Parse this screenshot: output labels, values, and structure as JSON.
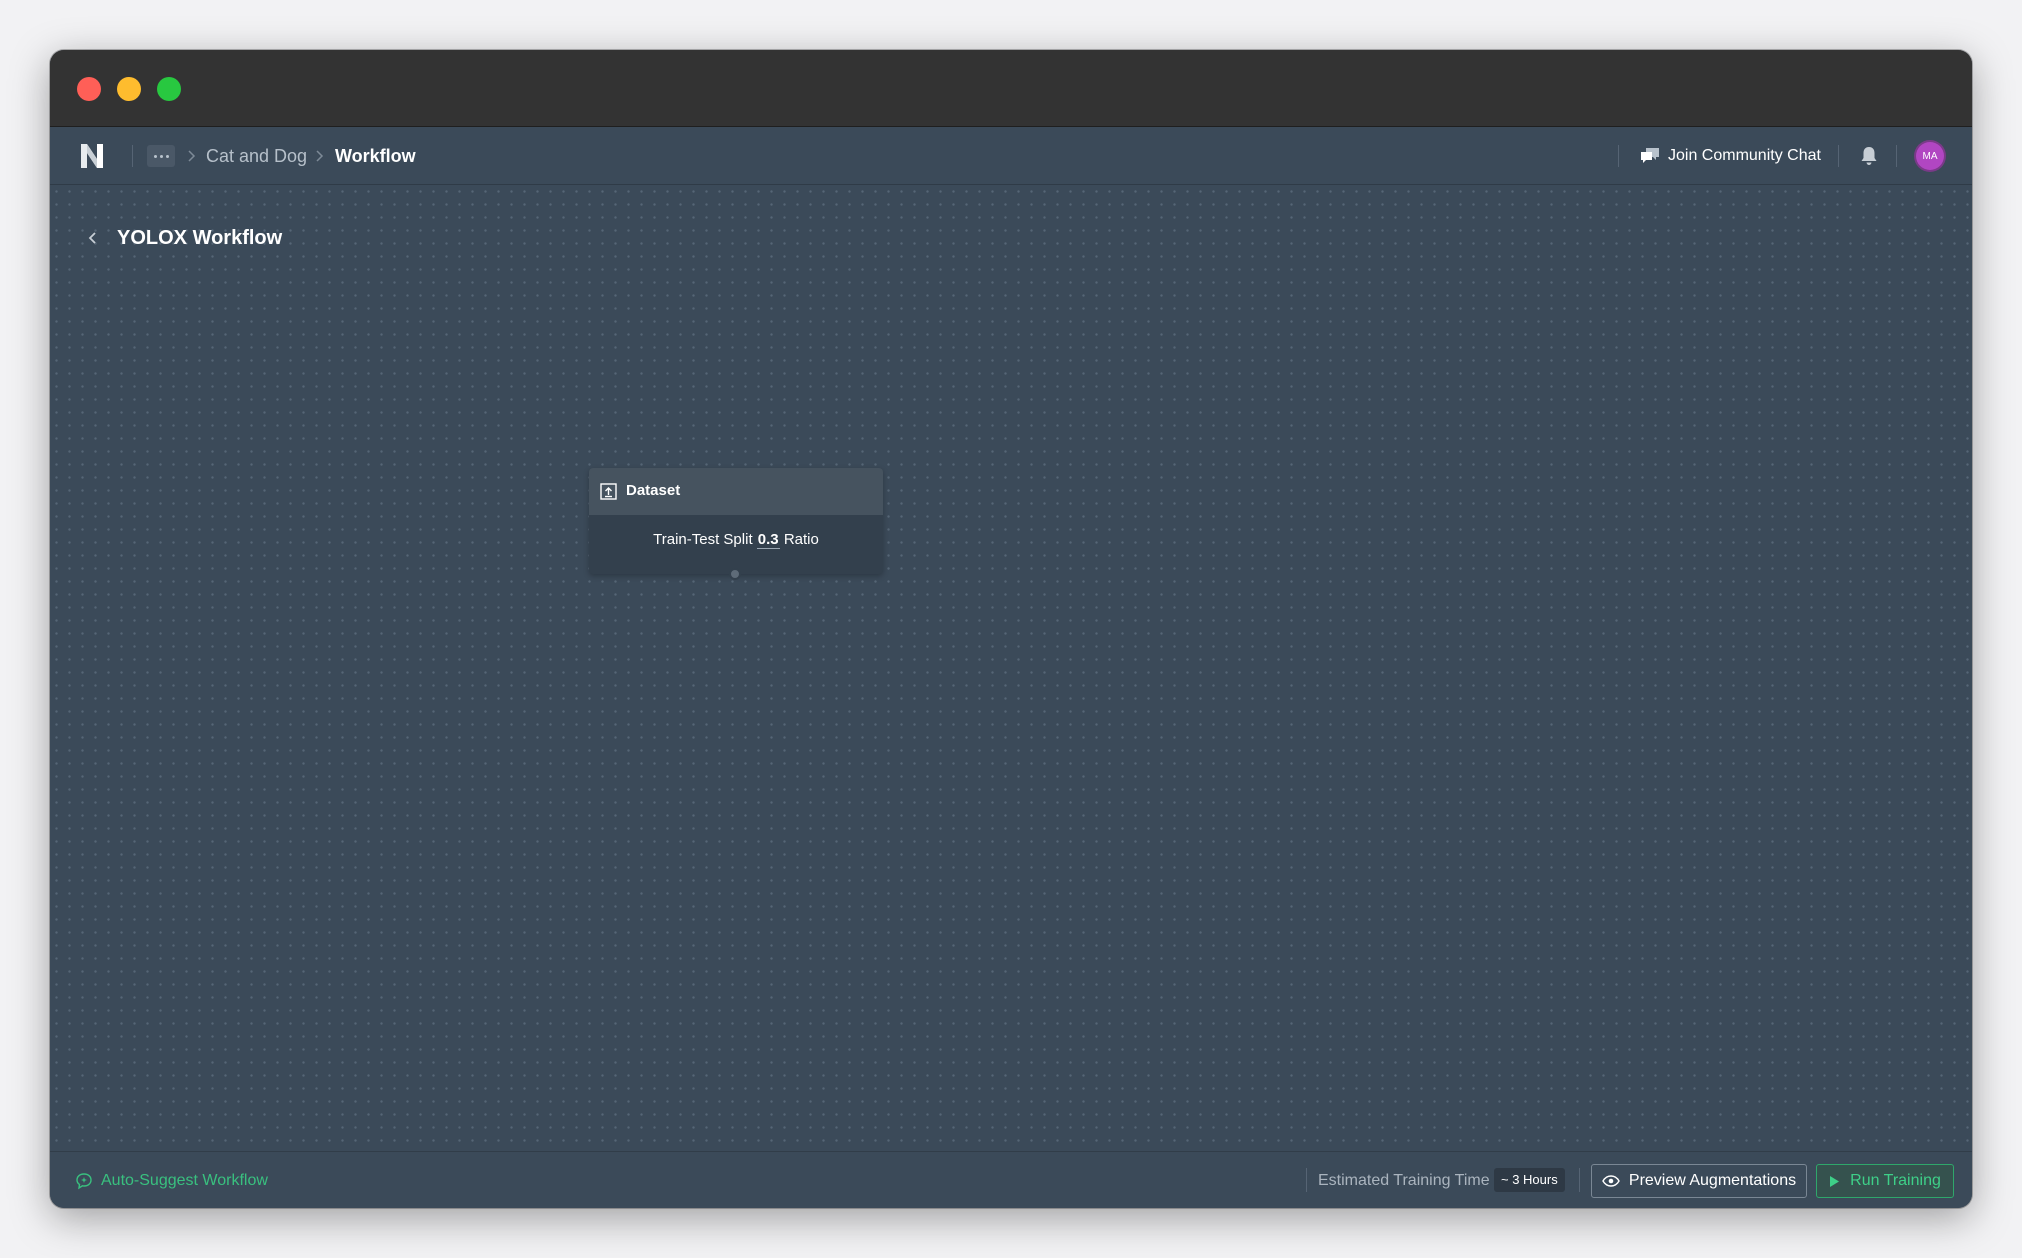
{
  "navbar": {
    "breadcrumb": {
      "more_label": "...",
      "project": "Cat and Dog",
      "current": "Workflow"
    },
    "community_label": "Join Community Chat",
    "avatar_initials": "MA"
  },
  "page": {
    "title": "YOLOX Workflow"
  },
  "node": {
    "title": "Dataset",
    "body_prefix": "Train-Test Split",
    "ratio": "0.3",
    "body_suffix": "Ratio"
  },
  "footer": {
    "auto_suggest_label": "Auto-Suggest Workflow",
    "estimated_label": "Estimated Training Time",
    "estimated_value": "~ 3 Hours",
    "preview_label": "Preview Augmentations",
    "run_label": "Run Training"
  },
  "colors": {
    "background": "#3b4a59",
    "titlebar": "#333333",
    "accent_green": "#39c07f",
    "avatar": "#b146c2",
    "node_header": "#46535f"
  },
  "icons": {
    "logo": "n-logo-icon",
    "community": "chat-bubbles-icon",
    "bell": "bell-icon",
    "back": "chevron-left-icon",
    "dataset": "dataset-upload-icon",
    "auto_suggest": "sparkle-chat-icon",
    "preview": "eye-icon",
    "run": "play-icon"
  }
}
